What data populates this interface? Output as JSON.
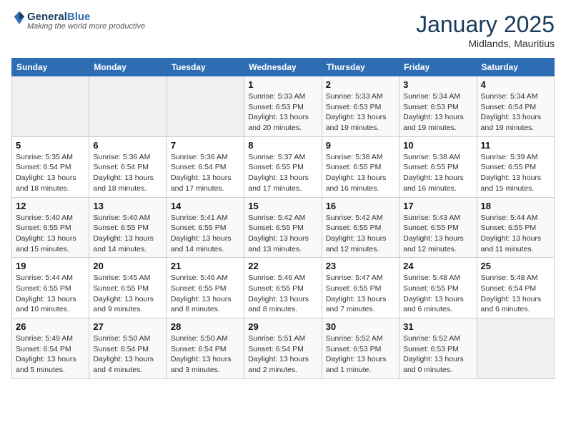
{
  "header": {
    "logo_general": "General",
    "logo_blue": "Blue",
    "month": "January 2025",
    "location": "Midlands, Mauritius"
  },
  "days_of_week": [
    "Sunday",
    "Monday",
    "Tuesday",
    "Wednesday",
    "Thursday",
    "Friday",
    "Saturday"
  ],
  "weeks": [
    [
      {
        "day": "",
        "info": ""
      },
      {
        "day": "",
        "info": ""
      },
      {
        "day": "",
        "info": ""
      },
      {
        "day": "1",
        "info": "Sunrise: 5:33 AM\nSunset: 6:53 PM\nDaylight: 13 hours and 20 minutes."
      },
      {
        "day": "2",
        "info": "Sunrise: 5:33 AM\nSunset: 6:53 PM\nDaylight: 13 hours and 19 minutes."
      },
      {
        "day": "3",
        "info": "Sunrise: 5:34 AM\nSunset: 6:53 PM\nDaylight: 13 hours and 19 minutes."
      },
      {
        "day": "4",
        "info": "Sunrise: 5:34 AM\nSunset: 6:54 PM\nDaylight: 13 hours and 19 minutes."
      }
    ],
    [
      {
        "day": "5",
        "info": "Sunrise: 5:35 AM\nSunset: 6:54 PM\nDaylight: 13 hours and 18 minutes."
      },
      {
        "day": "6",
        "info": "Sunrise: 5:36 AM\nSunset: 6:54 PM\nDaylight: 13 hours and 18 minutes."
      },
      {
        "day": "7",
        "info": "Sunrise: 5:36 AM\nSunset: 6:54 PM\nDaylight: 13 hours and 17 minutes."
      },
      {
        "day": "8",
        "info": "Sunrise: 5:37 AM\nSunset: 6:55 PM\nDaylight: 13 hours and 17 minutes."
      },
      {
        "day": "9",
        "info": "Sunrise: 5:38 AM\nSunset: 6:55 PM\nDaylight: 13 hours and 16 minutes."
      },
      {
        "day": "10",
        "info": "Sunrise: 5:38 AM\nSunset: 6:55 PM\nDaylight: 13 hours and 16 minutes."
      },
      {
        "day": "11",
        "info": "Sunrise: 5:39 AM\nSunset: 6:55 PM\nDaylight: 13 hours and 15 minutes."
      }
    ],
    [
      {
        "day": "12",
        "info": "Sunrise: 5:40 AM\nSunset: 6:55 PM\nDaylight: 13 hours and 15 minutes."
      },
      {
        "day": "13",
        "info": "Sunrise: 5:40 AM\nSunset: 6:55 PM\nDaylight: 13 hours and 14 minutes."
      },
      {
        "day": "14",
        "info": "Sunrise: 5:41 AM\nSunset: 6:55 PM\nDaylight: 13 hours and 14 minutes."
      },
      {
        "day": "15",
        "info": "Sunrise: 5:42 AM\nSunset: 6:55 PM\nDaylight: 13 hours and 13 minutes."
      },
      {
        "day": "16",
        "info": "Sunrise: 5:42 AM\nSunset: 6:55 PM\nDaylight: 13 hours and 12 minutes."
      },
      {
        "day": "17",
        "info": "Sunrise: 5:43 AM\nSunset: 6:55 PM\nDaylight: 13 hours and 12 minutes."
      },
      {
        "day": "18",
        "info": "Sunrise: 5:44 AM\nSunset: 6:55 PM\nDaylight: 13 hours and 11 minutes."
      }
    ],
    [
      {
        "day": "19",
        "info": "Sunrise: 5:44 AM\nSunset: 6:55 PM\nDaylight: 13 hours and 10 minutes."
      },
      {
        "day": "20",
        "info": "Sunrise: 5:45 AM\nSunset: 6:55 PM\nDaylight: 13 hours and 9 minutes."
      },
      {
        "day": "21",
        "info": "Sunrise: 5:46 AM\nSunset: 6:55 PM\nDaylight: 13 hours and 8 minutes."
      },
      {
        "day": "22",
        "info": "Sunrise: 5:46 AM\nSunset: 6:55 PM\nDaylight: 13 hours and 8 minutes."
      },
      {
        "day": "23",
        "info": "Sunrise: 5:47 AM\nSunset: 6:55 PM\nDaylight: 13 hours and 7 minutes."
      },
      {
        "day": "24",
        "info": "Sunrise: 5:48 AM\nSunset: 6:55 PM\nDaylight: 13 hours and 6 minutes."
      },
      {
        "day": "25",
        "info": "Sunrise: 5:48 AM\nSunset: 6:54 PM\nDaylight: 13 hours and 6 minutes."
      }
    ],
    [
      {
        "day": "26",
        "info": "Sunrise: 5:49 AM\nSunset: 6:54 PM\nDaylight: 13 hours and 5 minutes."
      },
      {
        "day": "27",
        "info": "Sunrise: 5:50 AM\nSunset: 6:54 PM\nDaylight: 13 hours and 4 minutes."
      },
      {
        "day": "28",
        "info": "Sunrise: 5:50 AM\nSunset: 6:54 PM\nDaylight: 13 hours and 3 minutes."
      },
      {
        "day": "29",
        "info": "Sunrise: 5:51 AM\nSunset: 6:54 PM\nDaylight: 13 hours and 2 minutes."
      },
      {
        "day": "30",
        "info": "Sunrise: 5:52 AM\nSunset: 6:53 PM\nDaylight: 13 hours and 1 minute."
      },
      {
        "day": "31",
        "info": "Sunrise: 5:52 AM\nSunset: 6:53 PM\nDaylight: 13 hours and 0 minutes."
      },
      {
        "day": "",
        "info": ""
      }
    ]
  ]
}
